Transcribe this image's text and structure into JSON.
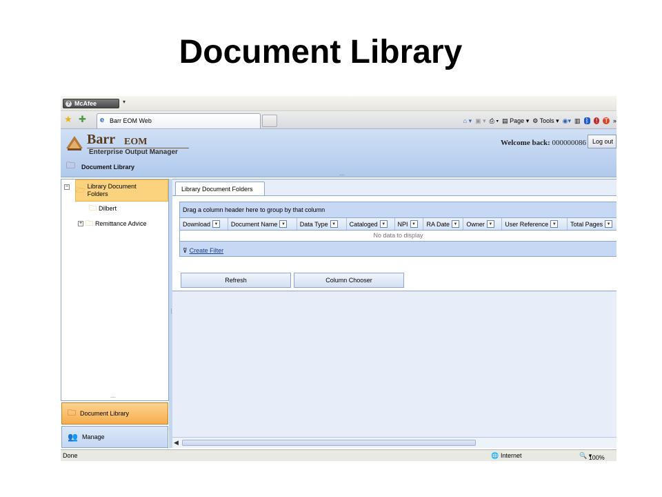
{
  "slide": {
    "title": "Document Library"
  },
  "browser": {
    "toolbar_mcafee": "McAfee",
    "tab_title": "Barr EOM Web",
    "ie_tools": {
      "page": "Page",
      "tools": "Tools"
    }
  },
  "header": {
    "logo_barr": "Barr",
    "logo_eom": "EOM",
    "logo_sub": "Enterprise Output Manager",
    "welcome_prefix": "Welcome back:",
    "welcome_user": "000000086",
    "logout": "Log out",
    "section_title": "Document Library"
  },
  "tree": {
    "root": "Library Document Folders",
    "items": [
      "Dilbert",
      "Remittance Advice"
    ]
  },
  "nav": {
    "items": [
      {
        "label": "Document Library",
        "active": true
      },
      {
        "label": "Manage",
        "active": false
      }
    ]
  },
  "main": {
    "tab": "Library Document Folders",
    "group_hint": "Drag a column header here to group by that column",
    "columns": [
      "Download",
      "Document Name",
      "Data Type",
      "Cataloged",
      "NPI",
      "RA Date",
      "Owner",
      "User Reference",
      "Total Pages"
    ],
    "empty_text": "No data to display",
    "filter_link": "Create Filter",
    "buttons": {
      "refresh": "Refresh",
      "column_chooser": "Column Chooser"
    }
  },
  "statusbar": {
    "left": "Done",
    "zone": "Internet",
    "zoom": "100%"
  },
  "colors": {
    "accent_blue": "#b0c9ec",
    "active_nav": "#f7ad4d",
    "selected_tree": "#fbd27d"
  }
}
